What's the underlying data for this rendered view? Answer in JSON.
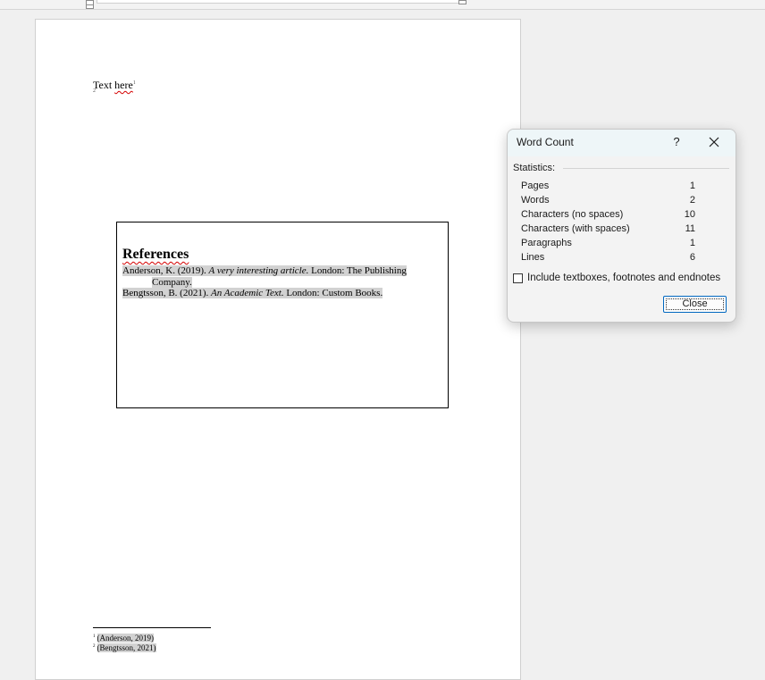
{
  "document": {
    "body_word1": "Text ",
    "body_word2": "here",
    "body_sup": "1",
    "body_mark": "2",
    "references": {
      "title": "References",
      "entry1_part1": "Anderson, K. (2019). ",
      "entry1_title": "A very interesting article.",
      "entry1_part2": " London: The Publishing",
      "entry1_cont": "Company.",
      "entry2_part1": "Bengtsson, B. (2021). ",
      "entry2_title": "An Academic Text.",
      "entry2_part2": " London: Custom Books."
    },
    "footnotes": [
      {
        "num": "1",
        "text": "(Anderson, 2019)"
      },
      {
        "num": "2",
        "text": "(Bengtsson, 2021)"
      }
    ]
  },
  "dialog": {
    "title": "Word Count",
    "help": "?",
    "statistics_label": "Statistics:",
    "stats": [
      {
        "label": "Pages",
        "value": "1"
      },
      {
        "label": "Words",
        "value": "2"
      },
      {
        "label": "Characters (no spaces)",
        "value": "10"
      },
      {
        "label": "Characters (with spaces)",
        "value": "11"
      },
      {
        "label": "Paragraphs",
        "value": "1"
      },
      {
        "label": "Lines",
        "value": "6"
      }
    ],
    "checkbox_label": "Include textboxes, footnotes and endnotes",
    "close_label": "Close"
  },
  "colors": {
    "spell_underline": "#d40000",
    "highlight": "#d2d2d2",
    "dialog_focus": "#0067c0"
  }
}
